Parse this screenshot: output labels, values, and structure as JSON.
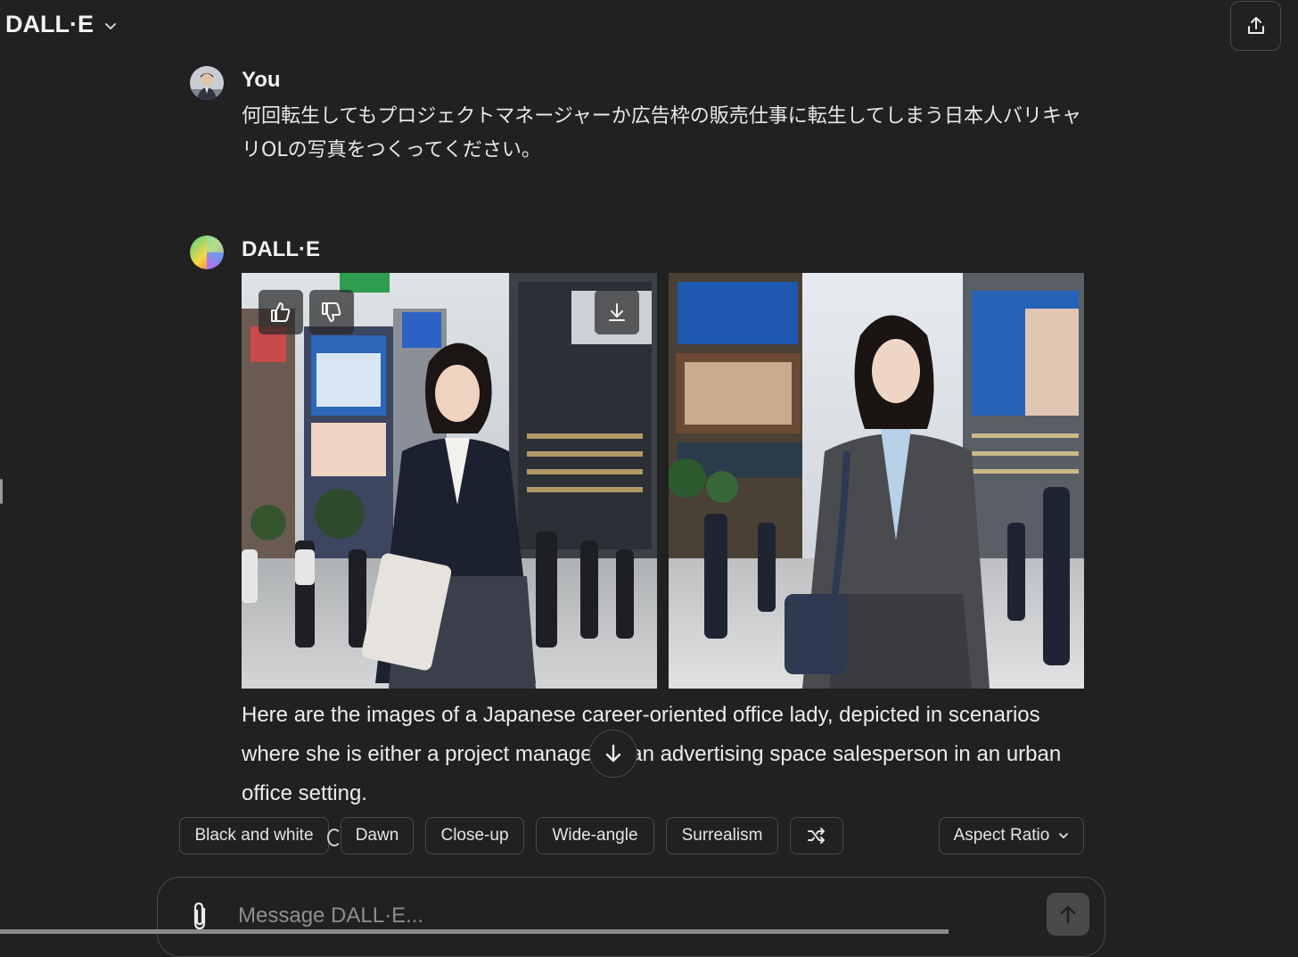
{
  "header": {
    "model_name": "DALL·E",
    "model_chevron_icon": "chevron-down-icon",
    "share_icon": "share-icon"
  },
  "user_message": {
    "author": "You",
    "text": "何回転生してもプロジェクトマネージャーか広告枠の販売仕事に転生してしまう日本人バリキャリOLの写真をつくってください。"
  },
  "assistant_message": {
    "author": "DALL·E",
    "images": [
      {
        "alt": "Japanese office lady in dark suit holding laptop on a busy city street"
      },
      {
        "alt": "Japanese office lady in gray suit with shoulder bag on a busy city street"
      }
    ],
    "image_actions": {
      "like_icon": "thumbs-up-icon",
      "dislike_icon": "thumbs-down-icon",
      "download_icon": "download-icon"
    },
    "text": "Here are the images of a Japanese career-oriented office lady, depicted in scenarios where she is either a project manager or an advertising space salesperson in an urban office setting."
  },
  "style_chips": [
    "Black and white",
    "Dawn",
    "Close-up",
    "Wide-angle",
    "Surrealism"
  ],
  "shuffle_icon": "shuffle-icon",
  "aspect_ratio": {
    "label": "Aspect Ratio",
    "icon": "chevron-down-icon"
  },
  "composer": {
    "placeholder": "Message DALL·E...",
    "attach_icon": "paperclip-icon",
    "send_icon": "arrow-up-icon"
  },
  "colors": {
    "background": "#212121",
    "border": "#4a4a4a",
    "text": "#ececec"
  }
}
